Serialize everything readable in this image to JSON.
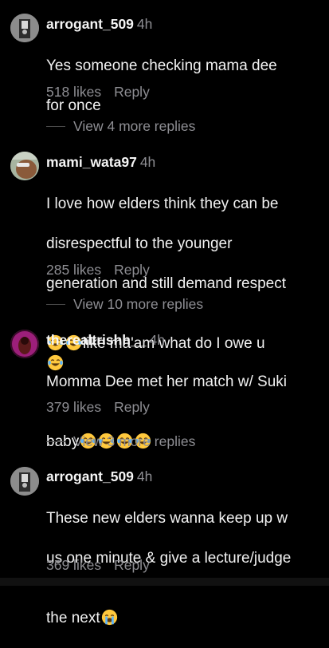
{
  "comments": [
    {
      "username": "arrogant_509",
      "time": "4h",
      "lines": [
        "Yes someone checking mama dee",
        "for once"
      ],
      "likes": "518 likes",
      "reply": "Reply",
      "view_more": "View 4 more replies",
      "avatar_icon": "profile-photo"
    },
    {
      "username": "mami_wata97",
      "time": "4h",
      "lines": [
        "I love how elders think they can be",
        "disrespectful to the younger",
        "generation and still demand respect",
        "like ma'am what do I owe u"
      ],
      "likes": "285 likes",
      "reply": "Reply",
      "view_more": "View 10 more replies",
      "avatar_icon": "profile-photo"
    },
    {
      "username": "therealtrishh__",
      "time": "4h",
      "lines": [
        "Momma Dee met her match w/ Suki",
        "baby"
      ],
      "likes": "379 likes",
      "reply": "Reply",
      "view_more": "View 3 more replies",
      "avatar_icon": "profile-photo"
    },
    {
      "username": "arrogant_509",
      "time": "4h",
      "lines": [
        "These new elders wanna keep up w",
        "us one minute & give a lecture/judge",
        "the next"
      ],
      "likes": "369 likes",
      "reply": "Reply",
      "avatar_icon": "profile-photo"
    }
  ],
  "emoji": {
    "laughing": "face-with-tears-of-joy-icon",
    "crying": "loudly-crying-face-icon"
  },
  "colors": {
    "background": "#000000",
    "text": "#f2f2f2",
    "muted": "#8e8e93",
    "emoji_yellow": "#ffc83d"
  }
}
